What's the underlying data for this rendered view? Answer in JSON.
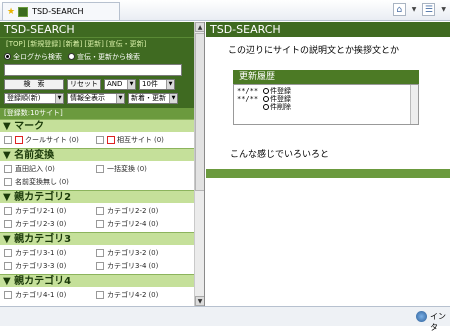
{
  "browser": {
    "tab_title": "TSD-SEARCH",
    "status_zone": "インタ"
  },
  "left": {
    "title": "TSD-SEARCH",
    "links": [
      "[TOP]",
      "[新規登録]",
      "[新着]",
      "[更新]",
      "[宣伝・更新]"
    ],
    "radio_all": "全ログから検索",
    "radio_ad": "宣伝・更新から検索",
    "search_button": "検　索",
    "reset_button": "リセット",
    "and_select": "AND",
    "count_select": "10件",
    "sort_select": "登録順(新)",
    "info_select": "情報全表示",
    "new_select": "新着・更新",
    "list_count": "[登録数:10サイト]",
    "sections": [
      {
        "title": "▼ マーク",
        "items": [
          {
            "label": "クールサイト",
            "count": "(0)",
            "mark": true
          },
          {
            "label": "相互サイト",
            "count": "(0)",
            "mark": true
          }
        ]
      },
      {
        "title": "▼ 名前変換",
        "items": [
          {
            "label": "直田記入",
            "count": "(0)"
          },
          {
            "label": "一括変換",
            "count": "(0)"
          },
          {
            "label": "名前変換無し",
            "count": "(0)"
          }
        ]
      },
      {
        "title": "▼ 親カテゴリ2",
        "items": [
          {
            "label": "カテゴリ2-1",
            "count": "(0)"
          },
          {
            "label": "カテゴリ2-2",
            "count": "(0)"
          },
          {
            "label": "カテゴリ2-3",
            "count": "(0)"
          },
          {
            "label": "カテゴリ2-4",
            "count": "(0)"
          }
        ]
      },
      {
        "title": "▼ 親カテゴリ3",
        "items": [
          {
            "label": "カテゴリ3-1",
            "count": "(0)"
          },
          {
            "label": "カテゴリ3-2",
            "count": "(0)"
          },
          {
            "label": "カテゴリ3-3",
            "count": "(0)"
          },
          {
            "label": "カテゴリ3-4",
            "count": "(0)"
          }
        ]
      },
      {
        "title": "▼ 親カテゴリ4",
        "items": [
          {
            "label": "カテゴリ4-1",
            "count": "(0)"
          },
          {
            "label": "カテゴリ4-2",
            "count": "(0)"
          }
        ]
      }
    ]
  },
  "right": {
    "title": "TSD-SEARCH",
    "description": "この辺りにサイトの説明文とか挨拶文とか",
    "update_header": "更新履歴",
    "update_lines": [
      {
        "date": "**/**",
        "text": "件登録"
      },
      {
        "date": "**/**",
        "text": "件登録"
      },
      {
        "date": "",
        "text": "件削除"
      }
    ],
    "closing": "こんな感じでいろいろと"
  },
  "colors": {
    "header_green": "#3f6a21",
    "section_green": "#c5e09a",
    "accent_green": "#6b9a3e"
  }
}
